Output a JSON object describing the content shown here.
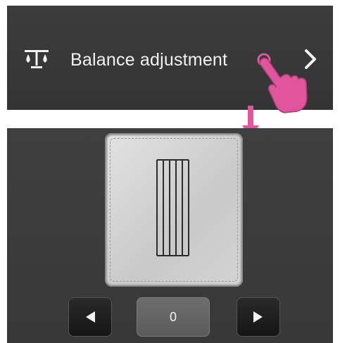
{
  "menu": {
    "label": "Balance adjustment",
    "icon": "balance-scale-icon",
    "chevron_icon": "chevron-right-icon"
  },
  "gesture": {
    "hand_icon": "tap-hand-icon",
    "arrow_icon": "arrow-down-icon",
    "color": "#e0559b"
  },
  "balance": {
    "value": "0",
    "decrease_icon": "triangle-left-icon",
    "increase_icon": "triangle-right-icon"
  }
}
